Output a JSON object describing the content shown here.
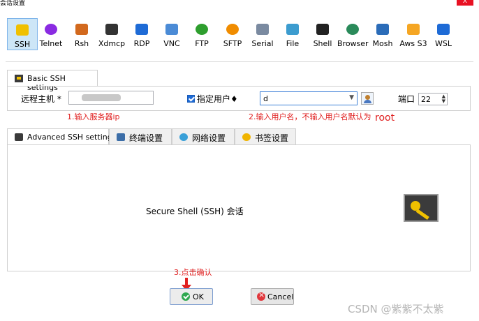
{
  "window": {
    "title": "会话设置",
    "close_label": "X"
  },
  "toolbar": {
    "items": [
      {
        "label": "SSH",
        "icon": "ssh-icon",
        "color": "#f0c000",
        "active": true
      },
      {
        "label": "Telnet",
        "icon": "telnet-icon",
        "color": "#8a2be2"
      },
      {
        "label": "Rsh",
        "icon": "rsh-icon",
        "color": "#d2691e"
      },
      {
        "label": "Xdmcp",
        "icon": "xdmcp-icon",
        "color": "#333333"
      },
      {
        "label": "RDP",
        "icon": "rdp-icon",
        "color": "#1e6bd6"
      },
      {
        "label": "VNC",
        "icon": "vnc-icon",
        "color": "#4b8bd6"
      },
      {
        "label": "FTP",
        "icon": "ftp-icon",
        "color": "#2e9e2e"
      },
      {
        "label": "SFTP",
        "icon": "sftp-icon",
        "color": "#f08c00"
      },
      {
        "label": "Serial",
        "icon": "serial-icon",
        "color": "#7a8aa0"
      },
      {
        "label": "File",
        "icon": "file-icon",
        "color": "#3c9ccf"
      },
      {
        "label": "Shell",
        "icon": "shell-icon",
        "color": "#222222"
      },
      {
        "label": "Browser",
        "icon": "browser-icon",
        "color": "#2a8a5a"
      },
      {
        "label": "Mosh",
        "icon": "mosh-icon",
        "color": "#2b6cb8"
      },
      {
        "label": "Aws S3",
        "icon": "aws-s3-icon",
        "color": "#f5a623"
      },
      {
        "label": "WSL",
        "icon": "wsl-icon",
        "color": "#1e6bd6"
      }
    ]
  },
  "basic": {
    "tab_label": "Basic SSH settings",
    "host_label": "远程主机 *",
    "specify_user_label": "指定用户♦",
    "username_value": "d",
    "port_label": "端口",
    "port_value": "22"
  },
  "annotations": {
    "step1": "1.输入服务器ip",
    "step2": "2.输入用户名，不输入用户名默认为",
    "root": "root",
    "step3": "3.点击确认"
  },
  "advanced_tabs": [
    {
      "label": "Advanced SSH settings",
      "icon": "ssh-settings-icon",
      "color": "#3a3a3a"
    },
    {
      "label": "终端设置",
      "icon": "terminal-settings-icon",
      "color": "#3c6ea8"
    },
    {
      "label": "网络设置",
      "icon": "network-settings-icon",
      "color": "#3aa0d8"
    },
    {
      "label": "书签设置",
      "icon": "bookmark-star-icon",
      "color": "#f0b400"
    }
  ],
  "main": {
    "description": "Secure Shell (SSH) 会话"
  },
  "buttons": {
    "ok_label": "OK",
    "cancel_label": "Cancel"
  },
  "watermark": "CSDN @紫紫不太紫",
  "colors": {
    "accent": "#1e6bd6",
    "annotation": "#e02020",
    "ok_icon": "#2fa84f",
    "cancel_icon": "#e0363b"
  }
}
